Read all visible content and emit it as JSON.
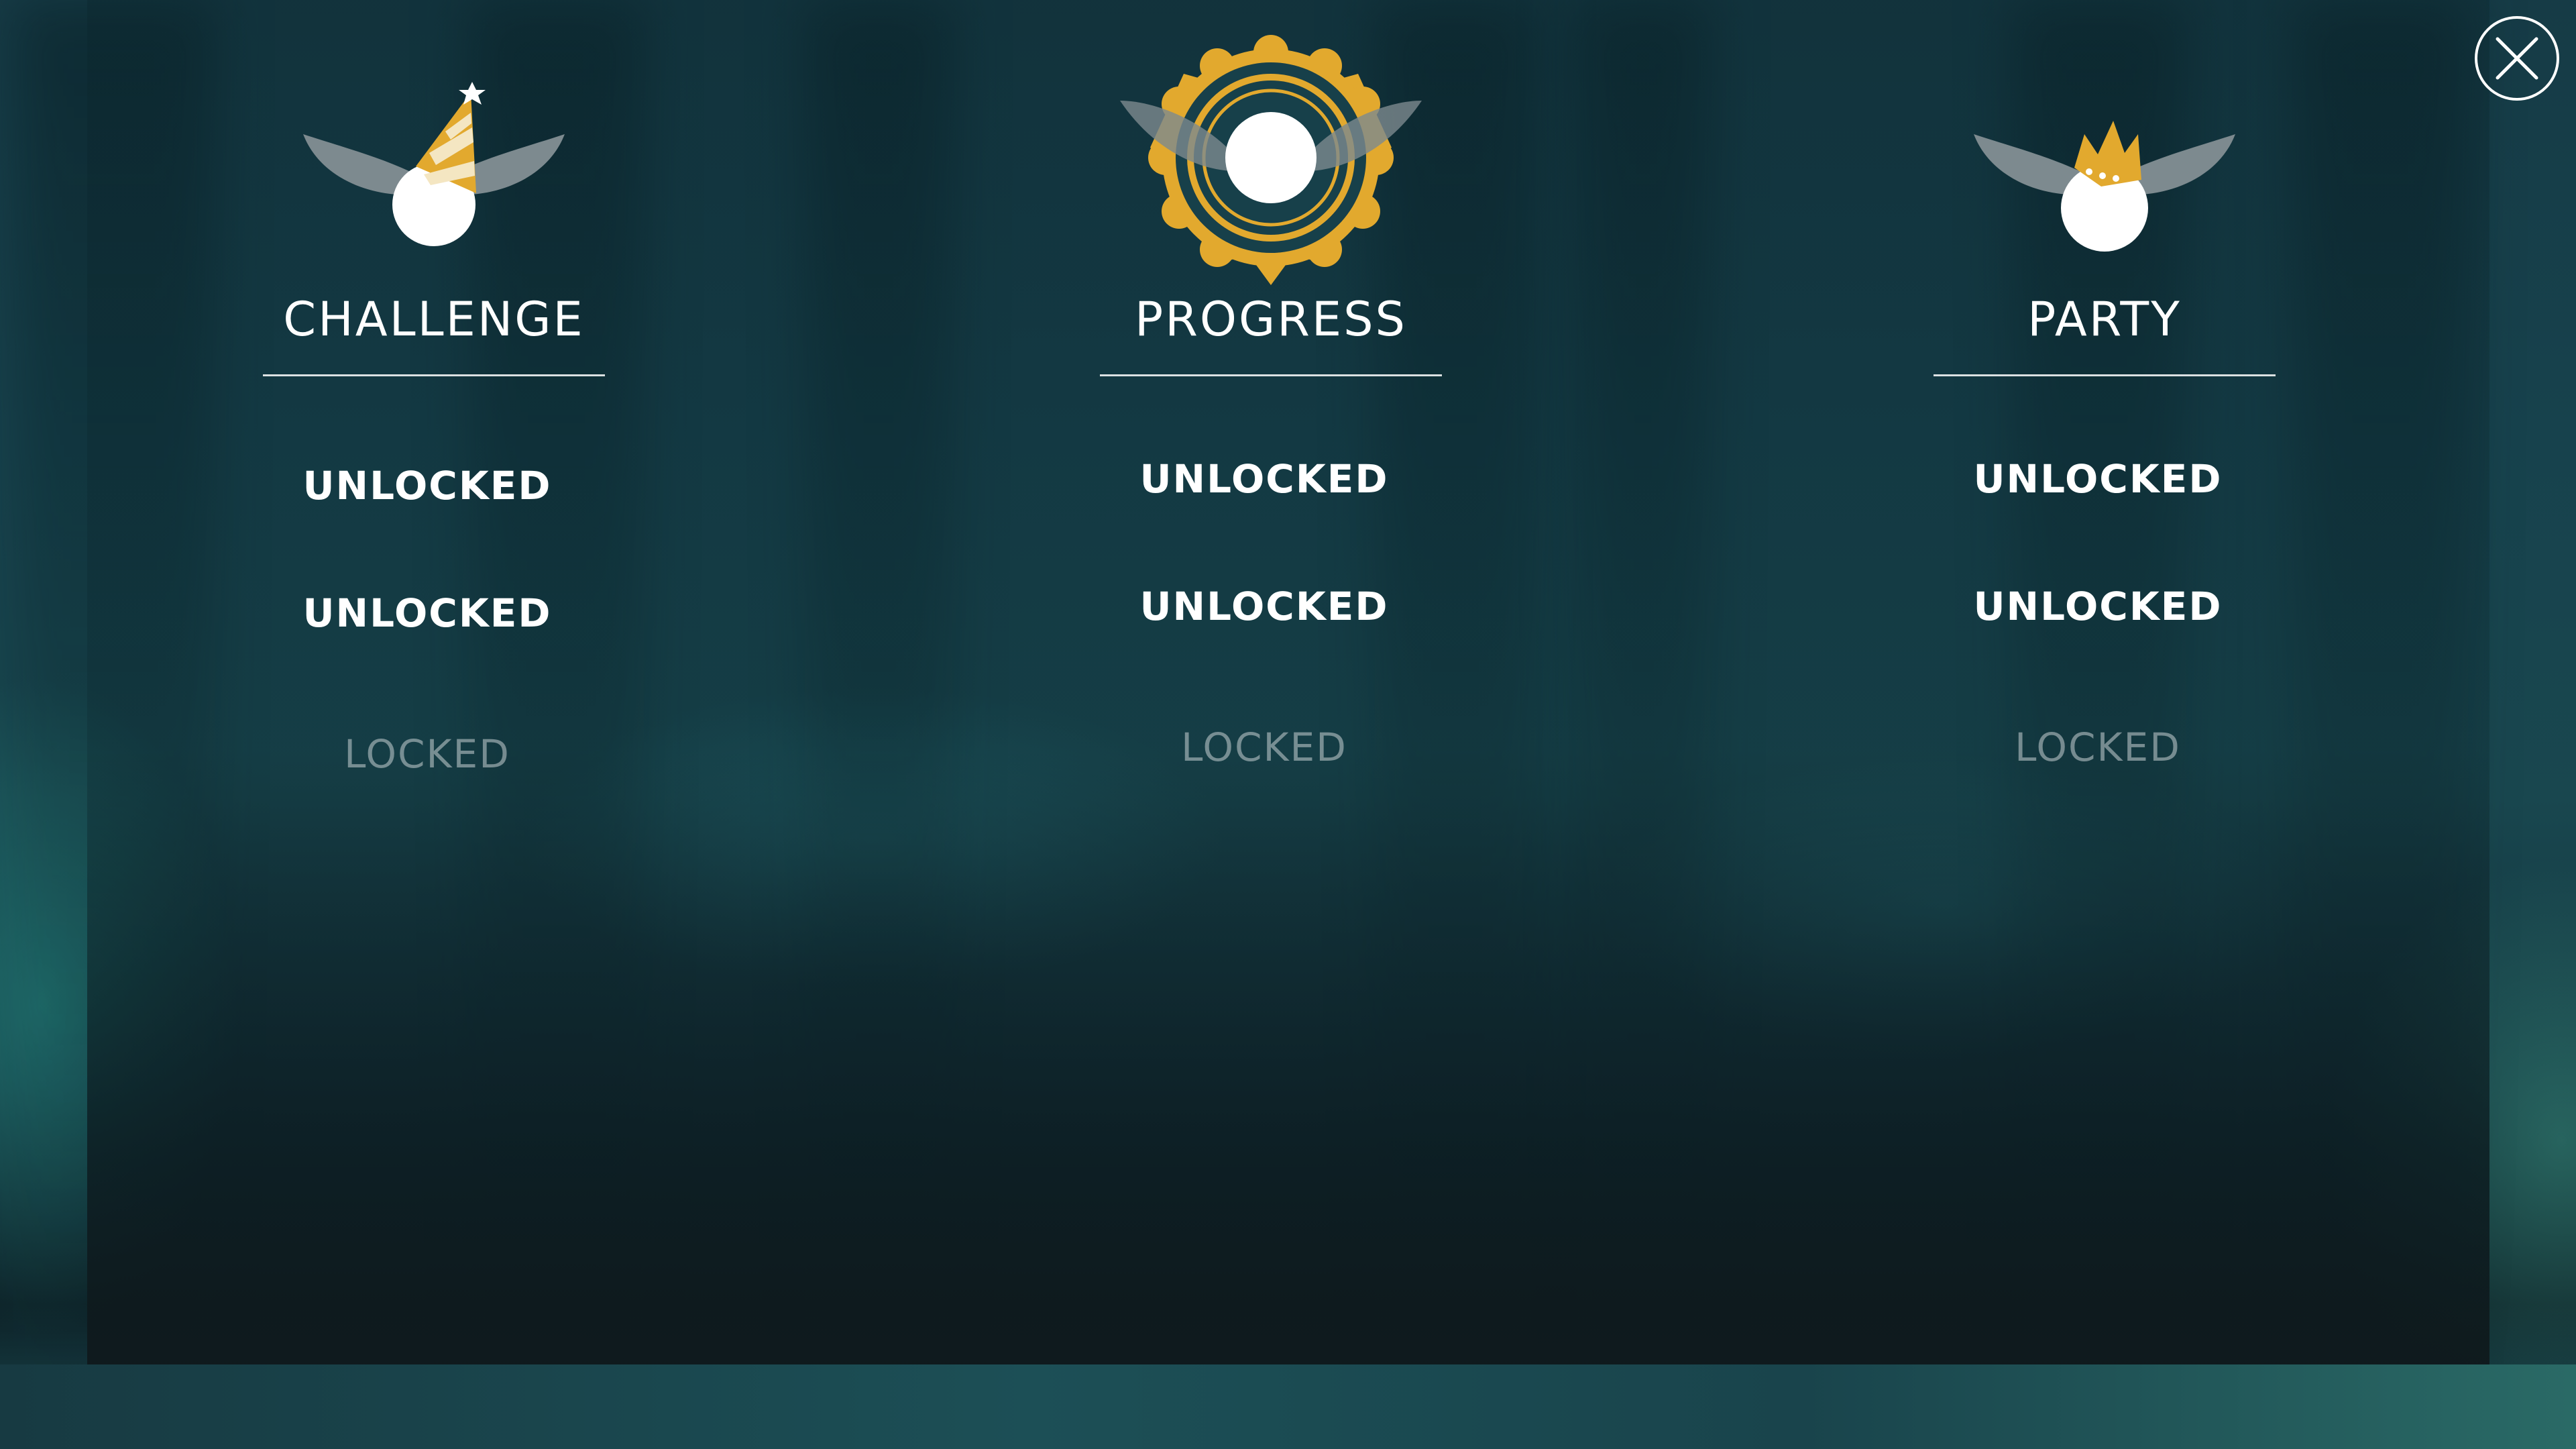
{
  "categories": [
    {
      "title": "CHALLENGE",
      "icon": "party-hat-orb-icon",
      "statuses": [
        "UNLOCKED",
        "UNLOCKED",
        "LOCKED"
      ]
    },
    {
      "title": "PROGRESS",
      "icon": "medal-orb-icon",
      "statuses": [
        "UNLOCKED",
        "UNLOCKED",
        "LOCKED"
      ]
    },
    {
      "title": "PARTY",
      "icon": "crown-orb-icon",
      "statuses": [
        "UNLOCKED",
        "UNLOCKED",
        "LOCKED"
      ]
    }
  ],
  "close_icon": "close-icon",
  "colors": {
    "accent_gold": "#e2a92e",
    "wing_gray": "#7d8a8f",
    "unlocked_text": "#ffffff",
    "locked_text": "#8e9ea2"
  }
}
